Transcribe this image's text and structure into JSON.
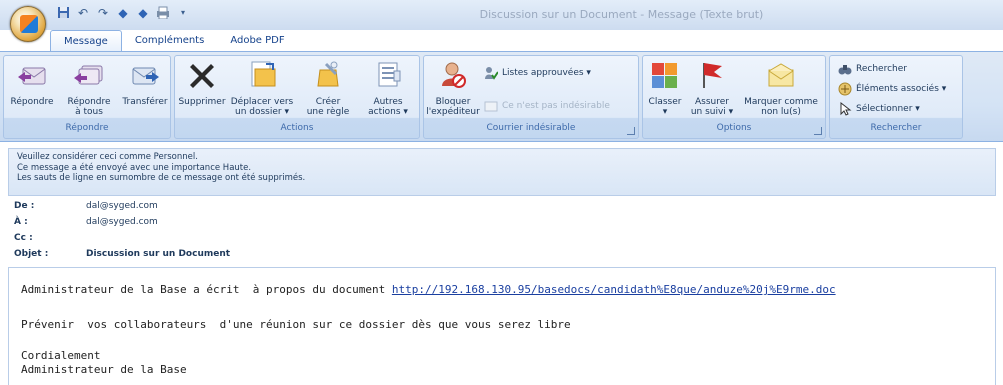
{
  "window": {
    "title": "Discussion sur un Document - Message (Texte brut)"
  },
  "quick_access": [
    "save-icon",
    "undo-icon",
    "redo-icon",
    "up-arrow-icon",
    "down-arrow-icon",
    "print-icon",
    "customize-icon"
  ],
  "tabs": [
    {
      "label": "Message"
    },
    {
      "label": "Compléments"
    },
    {
      "label": "Adobe PDF"
    }
  ],
  "ribbon": {
    "respond": {
      "label": "Répondre",
      "reply": "Répondre",
      "reply_all_1": "Répondre",
      "reply_all_2": "à tous",
      "forward": "Transférer"
    },
    "actions": {
      "label": "Actions",
      "delete": "Supprimer",
      "move_1": "Déplacer vers",
      "move_2": "un dossier ▾",
      "rule_1": "Créer",
      "rule_2": "une règle",
      "other_1": "Autres",
      "other_2": "actions ▾"
    },
    "junk": {
      "label": "Courrier indésirable",
      "block_1": "Bloquer",
      "block_2": "l'expéditeur",
      "safe_lists": "Listes approuvées ▾",
      "not_junk": "Ce n'est pas indésirable"
    },
    "options": {
      "label": "Options",
      "categorize": "Classer",
      "followup_1": "Assurer",
      "followup_2": "un suivi ▾",
      "unread_1": "Marquer comme",
      "unread_2": "non lu(s)"
    },
    "find": {
      "label": "Rechercher",
      "find": "Rechercher",
      "related": "Éléments associés ▾",
      "select": "Sélectionner ▾"
    }
  },
  "infobar": {
    "line1": "Veuillez considérer ceci comme Personnel.",
    "line2": "Ce message a été envoyé avec une importance Haute.",
    "line3": "Les sauts de ligne en surnombre de ce message ont été supprimés."
  },
  "headers": {
    "from_label": "De :",
    "from": "dal@syged.com",
    "to_label": "À :",
    "to": "dal@syged.com",
    "cc_label": "Cc :",
    "cc": "",
    "subject_label": "Objet :",
    "subject": "Discussion sur un Document"
  },
  "body": {
    "line1_prefix": "Administrateur de la Base a écrit  à propos du document ",
    "line1_link": "http://192.168.130.95/basedocs/candidath%E8que/anduze%20j%E9rme.doc",
    "line2": "Prévenir  vos collaborateurs  d'une réunion sur ce dossier dès que vous serez libre",
    "line3": "Cordialement",
    "line4": "Administrateur de la Base"
  }
}
